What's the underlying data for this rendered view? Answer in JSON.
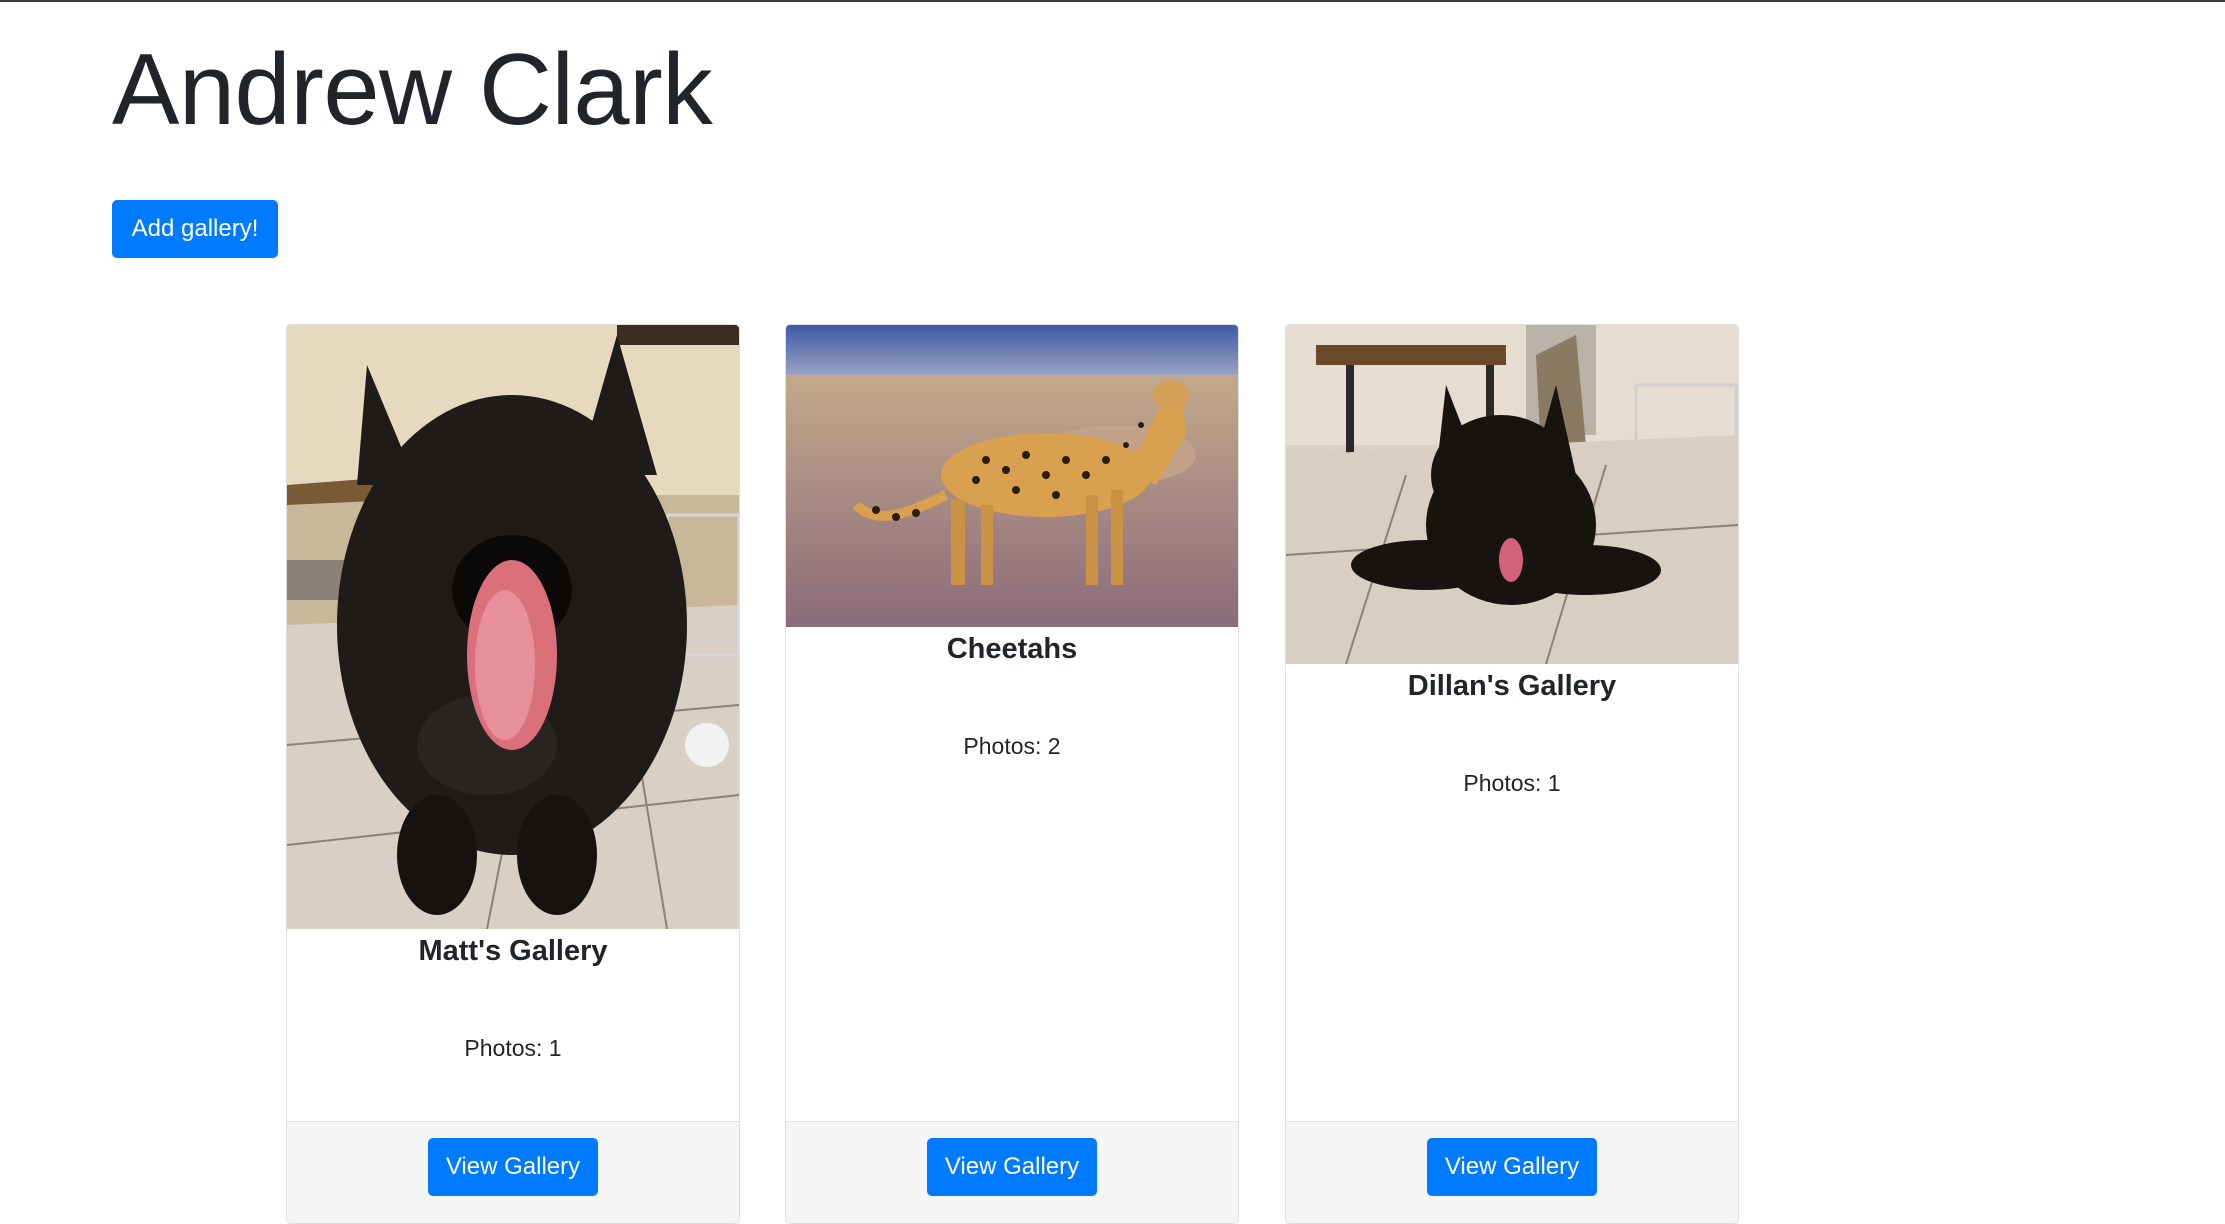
{
  "page": {
    "title": "Andrew Clark",
    "add_button_label": "Add gallery!"
  },
  "galleries": [
    {
      "name": "Matt's Gallery",
      "photos_text": "Photos: 1",
      "button_label": "View Gallery",
      "image_subject": "dog licking nose close-up"
    },
    {
      "name": "Cheetahs",
      "photos_text": "Photos: 2",
      "button_label": "View Gallery",
      "image_subject": "cheetah standing in grass"
    },
    {
      "name": "Dillan's Gallery",
      "photos_text": "Photos: 1",
      "button_label": "View Gallery",
      "image_subject": "black dog lying on tile floor"
    }
  ],
  "colors": {
    "primary": "#007bff",
    "text": "#212529",
    "card_border": "#dfdfdf",
    "footer_bg": "#f5f5f5"
  }
}
